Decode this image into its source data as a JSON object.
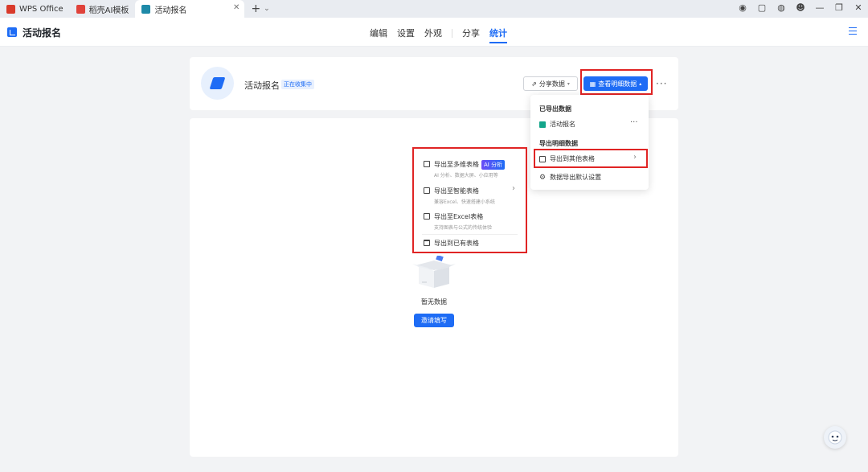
{
  "tabs": [
    {
      "label": "WPS Office",
      "color": "#d93a2b"
    },
    {
      "label": "稻壳AI模板",
      "color": "#e0423a"
    },
    {
      "label": "活动报名",
      "color": "#1e8aa8"
    }
  ],
  "app": {
    "title": "活动报名"
  },
  "nav": {
    "items": [
      "编辑",
      "设置",
      "外观"
    ],
    "share": "分享",
    "stats": "统计"
  },
  "form": {
    "name": "活动报名",
    "status": "正在收集中"
  },
  "actions": {
    "share_data": "分享数据",
    "view_details": "查看明细数据"
  },
  "export_menu": {
    "exported_section": "已导出数据",
    "exported_item": "活动报名",
    "export_section": "导出明细数据",
    "export_other": "导出到其他表格",
    "default_settings": "数据导出默认设置"
  },
  "submenu": {
    "item1_title": "导出至多维表格",
    "item1_badge": "AI 分析",
    "item1_desc": "AI 分析、数据大屏、小应用等",
    "item2_title": "导出至智能表格",
    "item2_desc": "兼容Excel、快速搭建小系统",
    "item3_title": "导出至Excel表格",
    "item3_desc": "支持图表与公式的传统体验",
    "item4_title": "导出到已有表格"
  },
  "empty": {
    "label": "暂无数据",
    "invite": "邀请填写"
  },
  "colors": {
    "accent": "#1e6cf5",
    "highlight": "#e02424"
  }
}
